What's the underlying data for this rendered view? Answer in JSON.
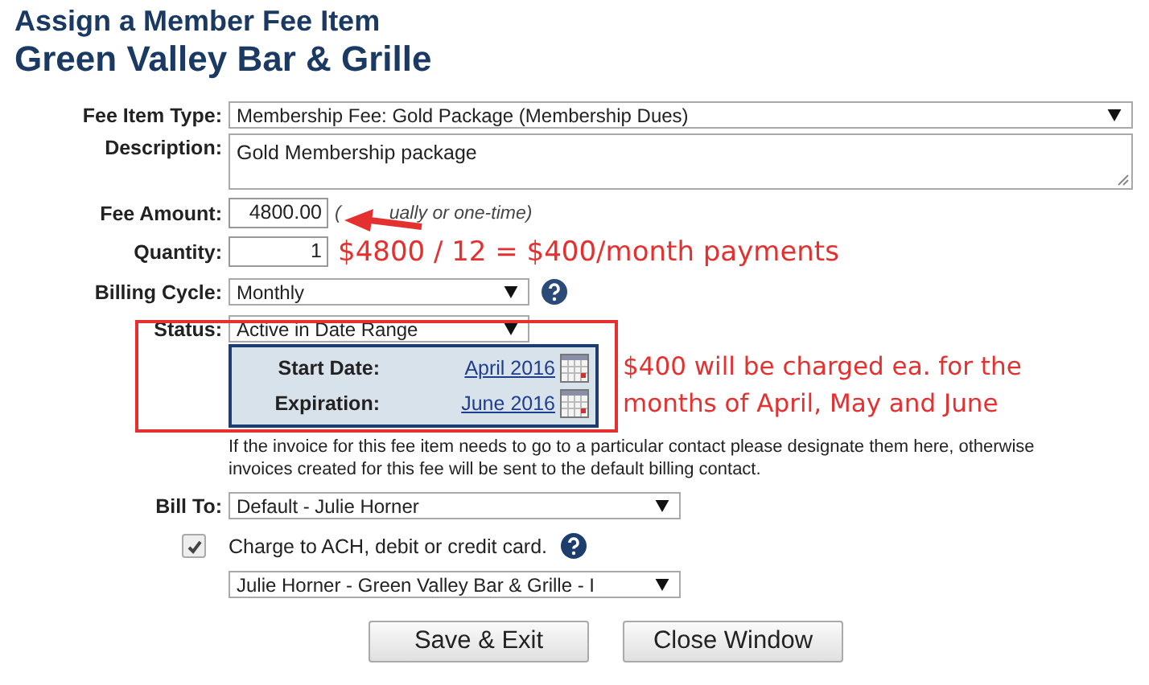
{
  "title": "Assign a Member Fee Item",
  "subtitle": "Green Valley Bar & Grille",
  "fee_item_type": {
    "label": "Fee Item Type:",
    "value": "Membership Fee: Gold Package (Membership Dues)"
  },
  "description": {
    "label": "Description:",
    "value": "Gold Membership package"
  },
  "fee_amount": {
    "label": "Fee Amount:",
    "value": "4800.00",
    "hint": [
      "(",
      "ually or one-time)"
    ]
  },
  "quantity": {
    "label": "Quantity:",
    "value": "1"
  },
  "billing_cycle": {
    "label": "Billing Cycle:",
    "value": "Monthly"
  },
  "status": {
    "label": "Status:",
    "value": "Active in Date Range"
  },
  "dates": [
    {
      "label": "Start Date:",
      "value": "April 2016"
    },
    {
      "label": "Expiration:",
      "value": "June 2016"
    }
  ],
  "bill_to_note": "If the invoice for this fee item needs to go to a particular contact please designate them here, otherwise invoices created for this fee will be sent to the default billing contact.",
  "bill_to": {
    "label": "Bill To:",
    "value": "Default - Julie Horner"
  },
  "charge": {
    "label": "Charge to ACH, debit or credit card.",
    "checked": true
  },
  "card": {
    "value": "Julie Horner - Green Valley Bar & Grille - I"
  },
  "buttons": [
    "Save & Exit",
    "Close Window"
  ],
  "annotations": [
    "$4800 / 12 = $400/month payments",
    "$400 will be charged ea. for the months of April, May and June"
  ]
}
